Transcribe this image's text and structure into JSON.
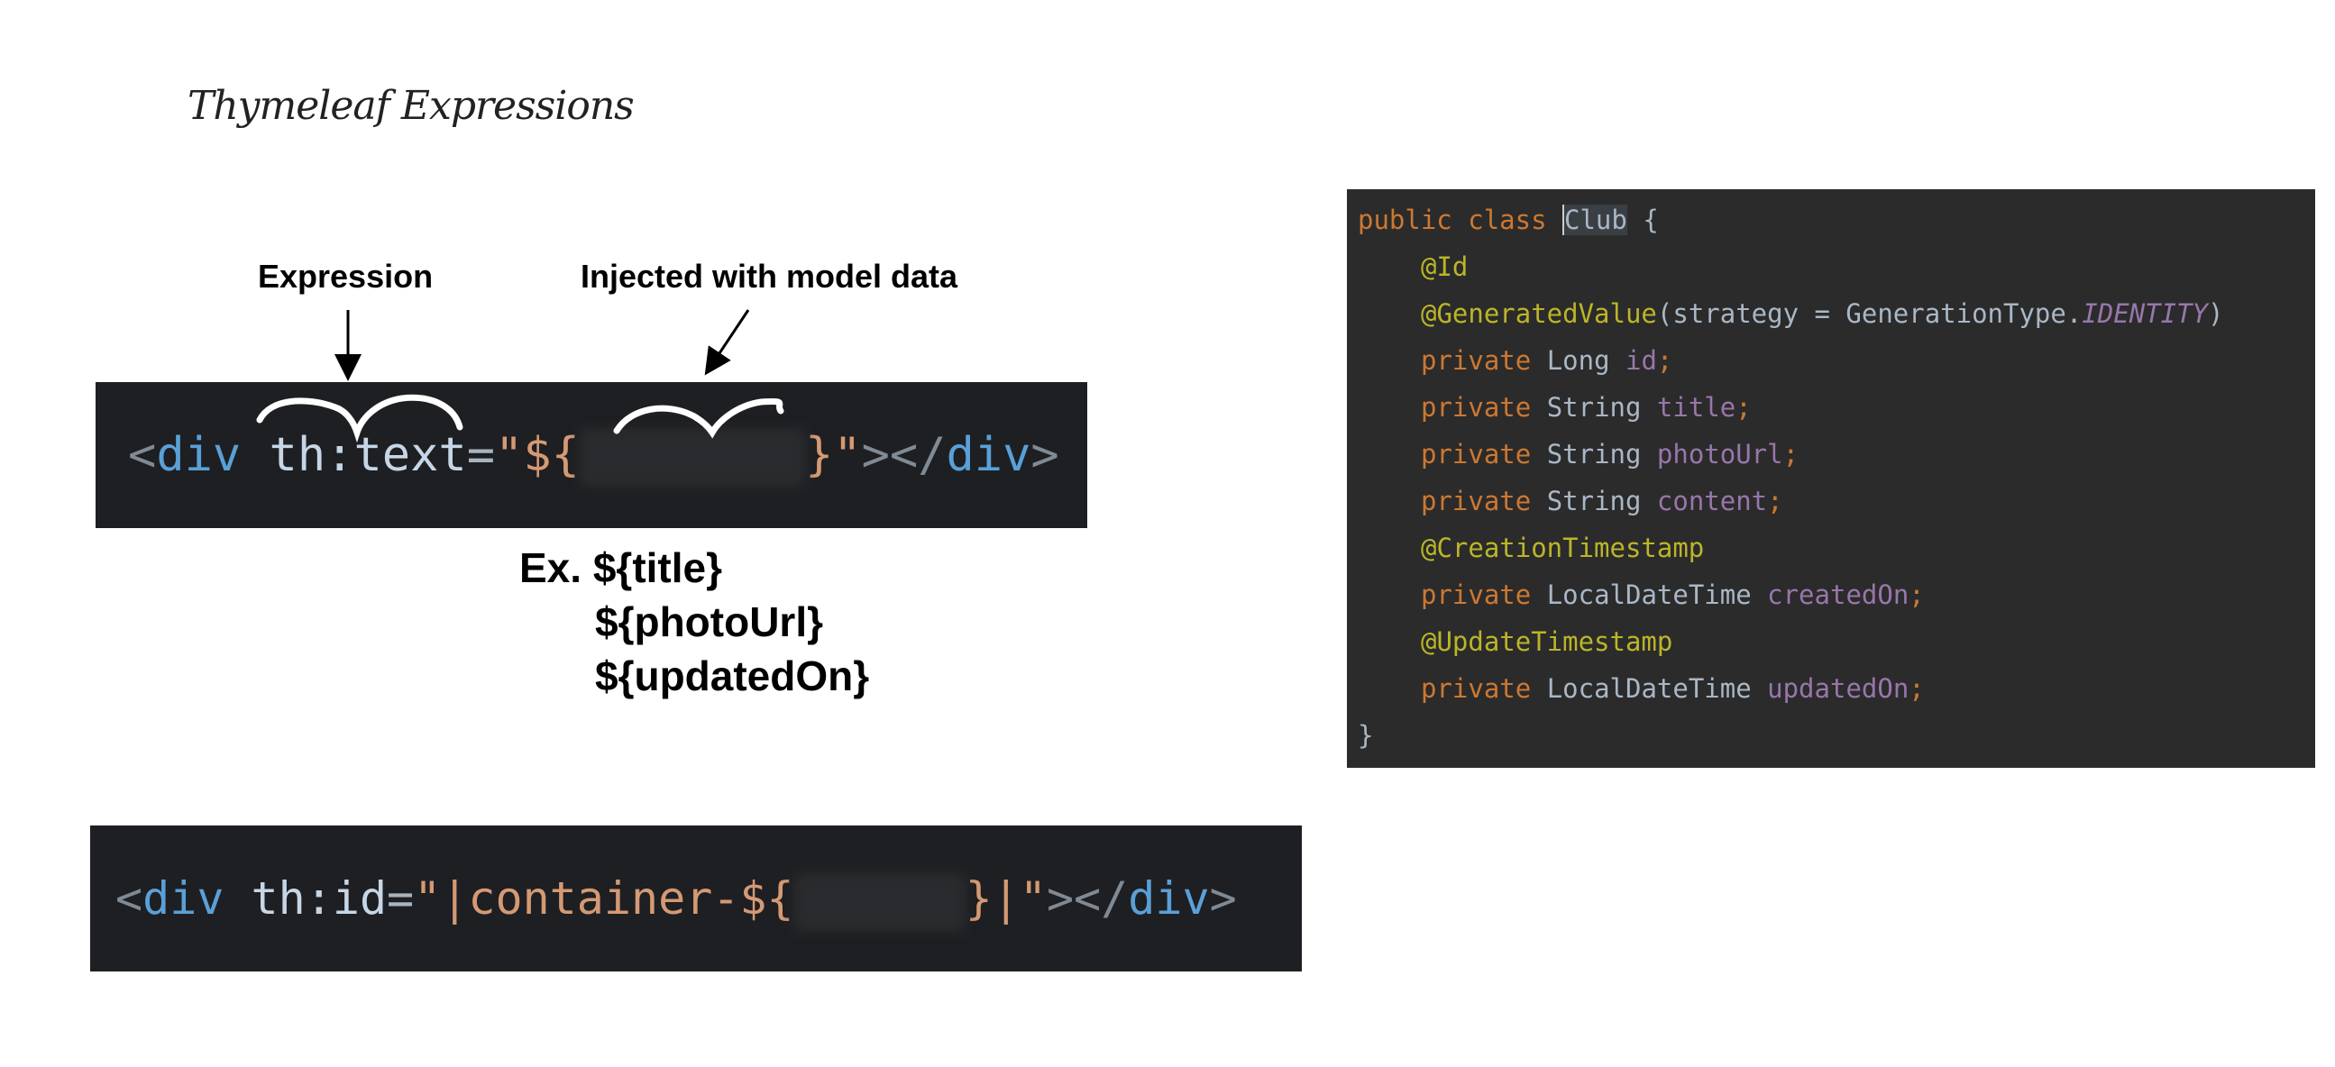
{
  "title": "Thymeleaf Expressions",
  "annotations": {
    "expression": "Expression",
    "injected": "Injected with model data"
  },
  "snippet_one": {
    "lt": "<",
    "tag_open": "div",
    "attr": "th:text",
    "eq": "=",
    "str_open": "\"${",
    "str_close": "}\"",
    "gt_close": "></",
    "tag_close": "div",
    "gt": ">"
  },
  "examples": {
    "prefix": "Ex.",
    "items": [
      "${title}",
      "${photoUrl}",
      "${updatedOn}"
    ]
  },
  "snippet_two": {
    "lt": "<",
    "tag_open": "div",
    "attr": "th:id",
    "eq": "=",
    "quote": "\"",
    "pipe": "|",
    "literal": "container-${",
    "close_brace": "}",
    "quote2": "\"",
    "gt_close": "></",
    "tag_close": "div",
    "gt": ">"
  },
  "ide": {
    "l1_kw1": "public",
    "l1_kw2": "class",
    "l1_cls": "Club",
    "l1_brace": "{",
    "ann_id": "@Id",
    "ann_generated": "@GeneratedValue",
    "gen_args_1": "(strategy = GenerationType.",
    "gen_identity": "IDENTITY",
    "gen_args_2": ")",
    "kw_private": "private",
    "t_long": "Long",
    "f_id": "id",
    "t_string": "String",
    "f_title": "title",
    "f_photo": "photoUrl",
    "f_content": "content",
    "ann_creation": "@CreationTimestamp",
    "t_ldt": "LocalDateTime",
    "f_created": "createdOn",
    "ann_update": "@UpdateTimestamp",
    "f_updated": "updatedOn",
    "semi": ";",
    "close_brace": "}"
  },
  "colors": {
    "code_bg": "#1e1f22",
    "ide_bg": "#2b2b2b",
    "tag": "#5aa0d8",
    "string": "#d49a74",
    "keyword": "#cc7832",
    "annotation": "#bbb529",
    "field": "#9876aa"
  }
}
